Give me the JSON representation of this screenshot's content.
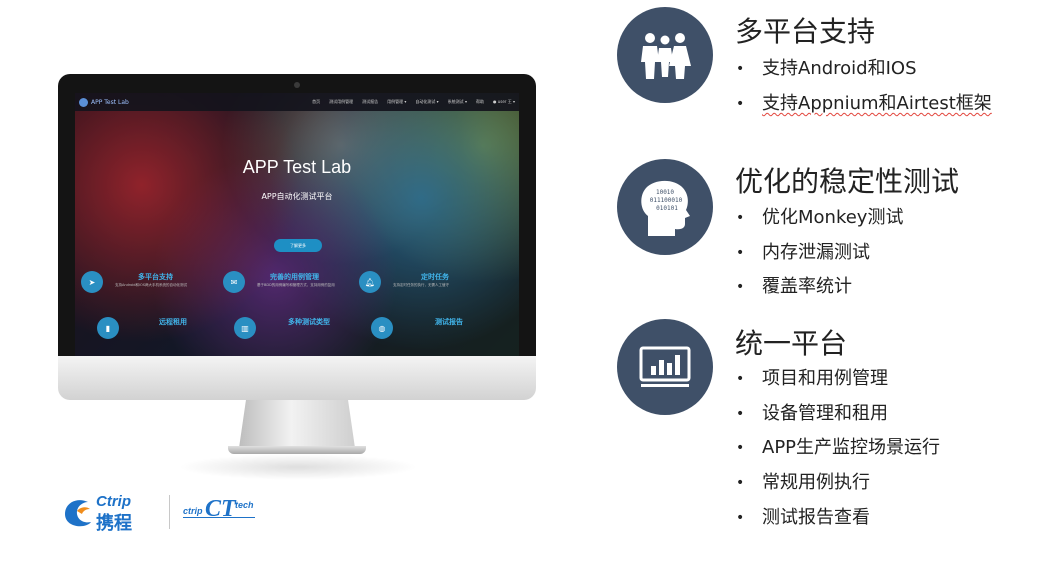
{
  "screen": {
    "brand": "APP Test Lab",
    "nav": [
      "首页",
      "测试用例管理",
      "测试报告",
      "用例管理 ▾",
      "自动化测试 ▾",
      "系统测试 ▾",
      "帮助",
      "● user 王 ▾"
    ],
    "hero_title": "APP Test Lab",
    "hero_subtitle": "APP自动化测试平台",
    "hero_button": "了解更多",
    "features": [
      {
        "title": "多平台支持",
        "desc": "支持Android和iOS两大手机系统的自动化测试",
        "icon": "paper-plane-icon"
      },
      {
        "title": "完善的用例管理",
        "desc": "基于BDD的用例编写和管理方式，支持用例的复用",
        "icon": "envelope-icon"
      },
      {
        "title": "定时任务",
        "desc": "支持定时任务的执行，无需人工值守",
        "icon": "bell-icon"
      },
      {
        "title": "远程租用",
        "desc": "",
        "icon": "phone-icon"
      },
      {
        "title": "多种测试类型",
        "desc": "",
        "icon": "chart-icon"
      },
      {
        "title": "测试报告",
        "desc": "",
        "icon": "globe-icon"
      }
    ]
  },
  "logos": {
    "ctrip_en": "Ctrip",
    "ctrip_cn": "携程",
    "ctriptech_left": "ctrip",
    "ctriptech_mid": "CT",
    "ctriptech_right": "tech"
  },
  "sections": [
    {
      "icon": "group-people-icon",
      "title": "多平台支持",
      "items": [
        "支持Android和IOS",
        "支持Appnium和Airtest框架"
      ]
    },
    {
      "icon": "binary-head-icon",
      "title": "优化的稳定性测试",
      "items": [
        "优化Monkey测试",
        "内存泄漏测试",
        "覆盖率统计"
      ],
      "icon_text": [
        "10010",
        "011100010",
        "010101"
      ]
    },
    {
      "icon": "bar-chart-monitor-icon",
      "title": "统一平台",
      "items": [
        "项目和用例管理",
        "设备管理和租用",
        "APP生产监控场景运行",
        "常规用例执行",
        "测试报告查看"
      ]
    }
  ],
  "bullet_char": "•",
  "colors": {
    "icon_circle": "#3f5068",
    "accent_blue": "#2a8fc2",
    "ctrip_blue": "#1e72c8",
    "ctrip_orange": "#f08d1c"
  }
}
